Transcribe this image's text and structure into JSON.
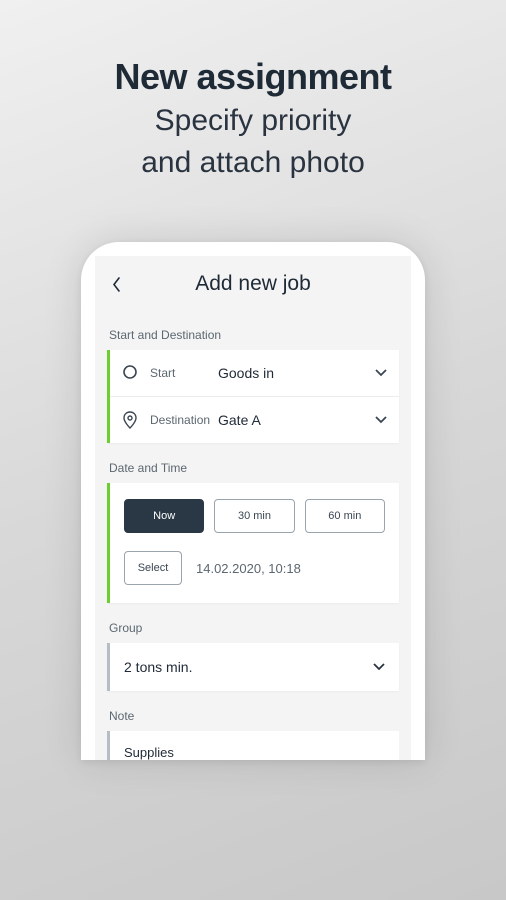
{
  "promo": {
    "title": "New assignment",
    "subtitle1": "Specify priority",
    "subtitle2": "and attach photo"
  },
  "appbar": {
    "title": "Add new job"
  },
  "sections": {
    "start_dest": {
      "label": "Start and Destination",
      "start_label": "Start",
      "start_value": "Goods in",
      "dest_label": "Destination",
      "dest_value": "Gate A"
    },
    "datetime": {
      "label": "Date and Time",
      "now": "Now",
      "thirty": "30 min",
      "sixty": "60 min",
      "select": "Select",
      "value": "14.02.2020, 10:18"
    },
    "group": {
      "label": "Group",
      "value": "2 tons min."
    },
    "note": {
      "label": "Note",
      "value": "Supplies"
    }
  }
}
